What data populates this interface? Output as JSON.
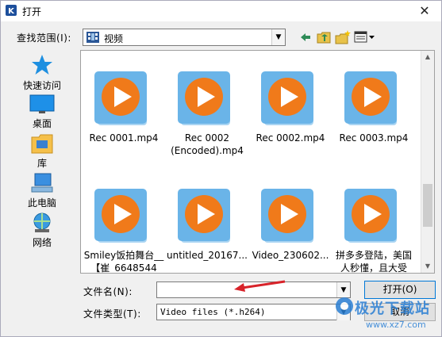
{
  "window": {
    "title": "打开"
  },
  "lookin": {
    "label": "查找范围(I):",
    "value": "视频"
  },
  "toolbar": {
    "back_icon": "back-arrow-icon",
    "up_icon": "up-folder-icon",
    "newfolder_icon": "new-folder-icon",
    "view_icon": "view-menu-icon"
  },
  "places": [
    {
      "label": "快速访问",
      "icon": "star-icon"
    },
    {
      "label": "桌面",
      "icon": "desktop-icon"
    },
    {
      "label": "库",
      "icon": "library-icon"
    },
    {
      "label": "此电脑",
      "icon": "computer-icon"
    },
    {
      "label": "网络",
      "icon": "network-icon"
    }
  ],
  "files": [
    {
      "name": "Rec 0001.mp4"
    },
    {
      "name": "Rec 0002\n(Encoded).mp4"
    },
    {
      "name": "Rec 0002.mp4"
    },
    {
      "name": "Rec 0003.mp4"
    },
    {
      "name": "Smiley饭拍舞台__\n【崔_6648544"
    },
    {
      "name": "untitled_20167..."
    },
    {
      "name": "Video_230602..."
    },
    {
      "name": "拼多多登陆，美国\n人秒懂，且大受"
    }
  ],
  "filename": {
    "label": "文件名(N):",
    "value": ""
  },
  "filetype": {
    "label": "文件类型(T):",
    "value": "Video files (*.h264)"
  },
  "buttons": {
    "open": "打开(O)",
    "cancel": "取消"
  },
  "watermark": {
    "line1": "极光下载站",
    "line2": "www.xz7.com"
  },
  "colors": {
    "accent": "#0078d7",
    "play_orange": "#f07a1a",
    "tile_blue": "#6ab4e8"
  }
}
